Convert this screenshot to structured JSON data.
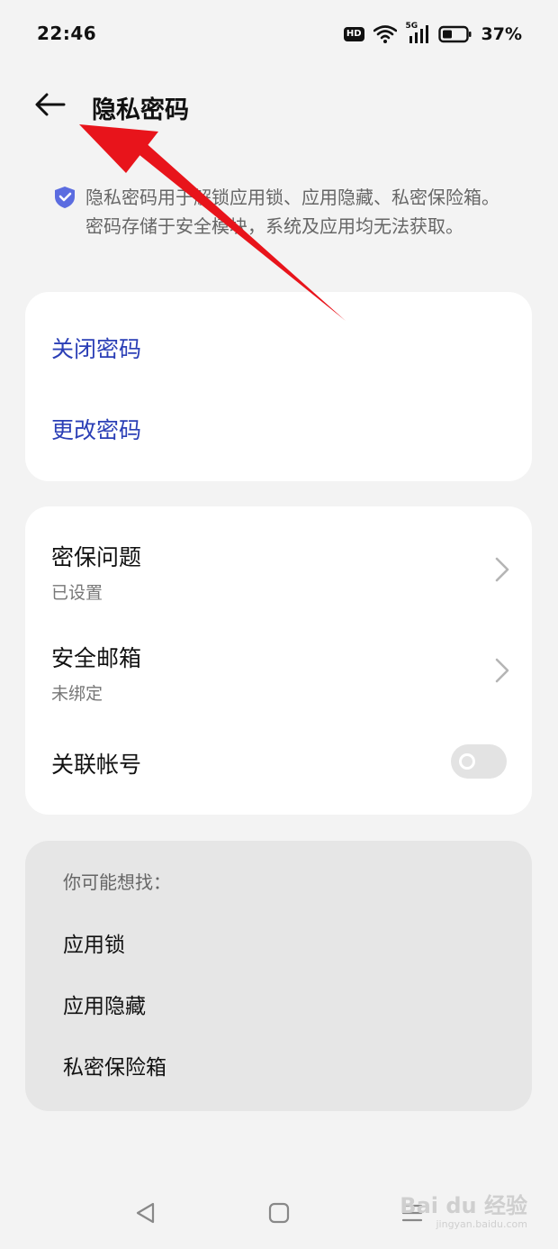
{
  "status_bar": {
    "time": "22:46",
    "hd": "HD",
    "network": "5G",
    "battery": "37%"
  },
  "header": {
    "title": "隐私密码"
  },
  "info": {
    "text": "隐私密码用于解锁应用锁、应用隐藏、私密保险箱。密码存储于安全模块，系统及应用均无法获取。"
  },
  "password_actions": {
    "close_password": "关闭密码",
    "change_password": "更改密码"
  },
  "security": {
    "question_title": "密保问题",
    "question_status": "已设置",
    "email_title": "安全邮箱",
    "email_status": "未绑定",
    "account_title": "关联帐号",
    "account_linked": false
  },
  "suggestions": {
    "heading": "你可能想找：",
    "items": [
      "应用锁",
      "应用隐藏",
      "私密保险箱"
    ]
  },
  "watermark": {
    "brand": "Bai du 经验",
    "site": "jingyan.baidu.com"
  },
  "colors": {
    "accent": "#2b3fb6",
    "annotation_arrow": "#e8141b"
  }
}
